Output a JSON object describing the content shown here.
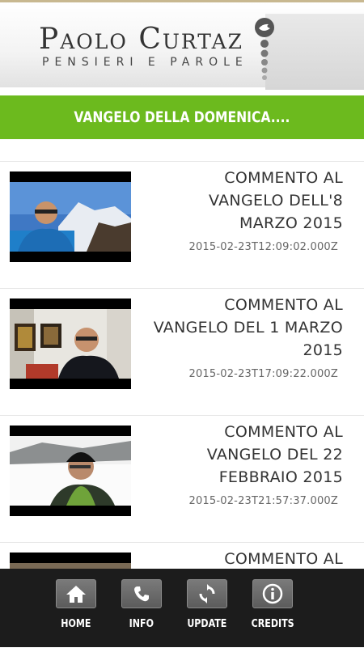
{
  "header": {
    "logo_title": "Paolo Curtaz",
    "logo_subtitle": "PENSIERI E PAROLE"
  },
  "section": {
    "title": "VANGELO DELLA DOMENICA...."
  },
  "videos": [
    {
      "title": "COMMENTO AL VANGELO DELL'8 MARZO 2015",
      "date": "2015-02-23T12:09:02.000Z"
    },
    {
      "title": "COMMENTO AL VANGELO DEL 1 MARZO 2015",
      "date": "2015-02-23T17:09:22.000Z"
    },
    {
      "title": "COMMENTO AL VANGELO DEL 22 FEBBRAIO 2015",
      "date": "2015-02-23T21:57:37.000Z"
    },
    {
      "title": "COMMENTO AL",
      "date": ""
    }
  ],
  "nav": [
    {
      "label": "HOME",
      "icon": "home-icon"
    },
    {
      "label": "INFO",
      "icon": "phone-icon"
    },
    {
      "label": "UPDATE",
      "icon": "refresh-icon"
    },
    {
      "label": "CREDITS",
      "icon": "info-icon"
    }
  ]
}
